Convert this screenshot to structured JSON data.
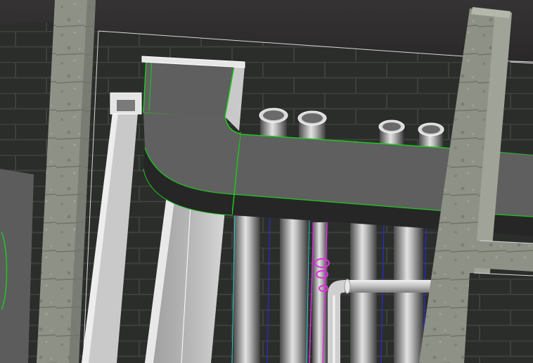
{
  "viewport": {
    "kind": "3d-bim-model-view",
    "visible_text": []
  },
  "scene": {
    "objects": [
      {
        "id": "ceiling-slab",
        "type": "ceiling",
        "selected": false
      },
      {
        "id": "back-wall",
        "type": "brick-wall",
        "selected": false
      },
      {
        "id": "left-column",
        "type": "concrete-column",
        "selected": false
      },
      {
        "id": "right-column",
        "type": "concrete-column",
        "selected": false
      },
      {
        "id": "duct-main",
        "type": "rectangular-duct",
        "selected": true,
        "highlight": "green"
      },
      {
        "id": "duct-elbow",
        "type": "duct-elbow",
        "selected": true,
        "highlight": "green"
      },
      {
        "id": "duct-riser",
        "type": "rectangular-duct",
        "selected": true,
        "highlight": "green"
      },
      {
        "id": "vertical-pipes",
        "type": "pipe",
        "count": 4
      },
      {
        "id": "magenta-pipe",
        "type": "pipe",
        "highlight": "magenta"
      },
      {
        "id": "horizontal-branch",
        "type": "pipe-branch"
      }
    ]
  },
  "colors": {
    "selection": "#1ec81e",
    "highlight": "#e030e0",
    "duct_face": "#5f5f5f",
    "duct_bottom": "#262626",
    "brick": "#2b2d2b",
    "mortar": "#3d403d",
    "concrete": "#8d9186",
    "ceiling": "#2c2a2b"
  }
}
